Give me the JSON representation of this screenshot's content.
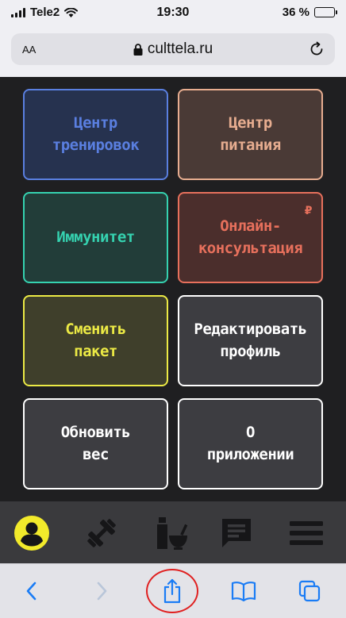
{
  "status_bar": {
    "carrier": "Tele2",
    "time": "19:30",
    "battery": "36 %",
    "battery_level": 0.36
  },
  "browser": {
    "text_size_label": "AA",
    "url": "culttela.ru"
  },
  "tiles": [
    {
      "label": "Центр\nтренировок",
      "color": "#5a7fe0",
      "bg": "#26324f",
      "border": "#5a7fe0"
    },
    {
      "label": "Центр\nпитания",
      "color": "#e7ad90",
      "bg": "#4a3a36",
      "border": "#e7ad90"
    },
    {
      "label": "Иммунитет",
      "color": "#35d2b0",
      "bg": "#223d39",
      "border": "#35d2b0"
    },
    {
      "label": "Онлайн-\nконсультация",
      "color": "#e7705c",
      "bg": "#4b2e2c",
      "border": "#e7705c",
      "badge": "₽"
    },
    {
      "label": "Сменить\nпакет",
      "color": "#ecea45",
      "bg": "#3f3f2b",
      "border": "#ecea45"
    },
    {
      "label": "Редактировать\nпрофиль",
      "color": "#ffffff",
      "bg": "#3d3d41",
      "border": "#ffffff"
    },
    {
      "label": "Обновить\nвес",
      "color": "#ffffff",
      "bg": "#3d3d41",
      "border": "#ffffff"
    },
    {
      "label": "О\nприложении",
      "color": "#ffffff",
      "bg": "#3d3d41",
      "border": "#ffffff"
    }
  ],
  "tabbar": {
    "items": [
      {
        "icon": "profile-icon",
        "active": true
      },
      {
        "icon": "dumbbell-icon"
      },
      {
        "icon": "nutrition-icon"
      },
      {
        "icon": "chat-icon"
      },
      {
        "icon": "menu-icon"
      }
    ],
    "active_color": "#f2ea2b",
    "icon_color": "#161618"
  },
  "toolbar": {
    "items": [
      "back-icon",
      "forward-icon",
      "share-icon",
      "bookmarks-icon",
      "tabs-icon"
    ],
    "accent": "#1a7cf5",
    "highlight_color": "#e02020"
  }
}
